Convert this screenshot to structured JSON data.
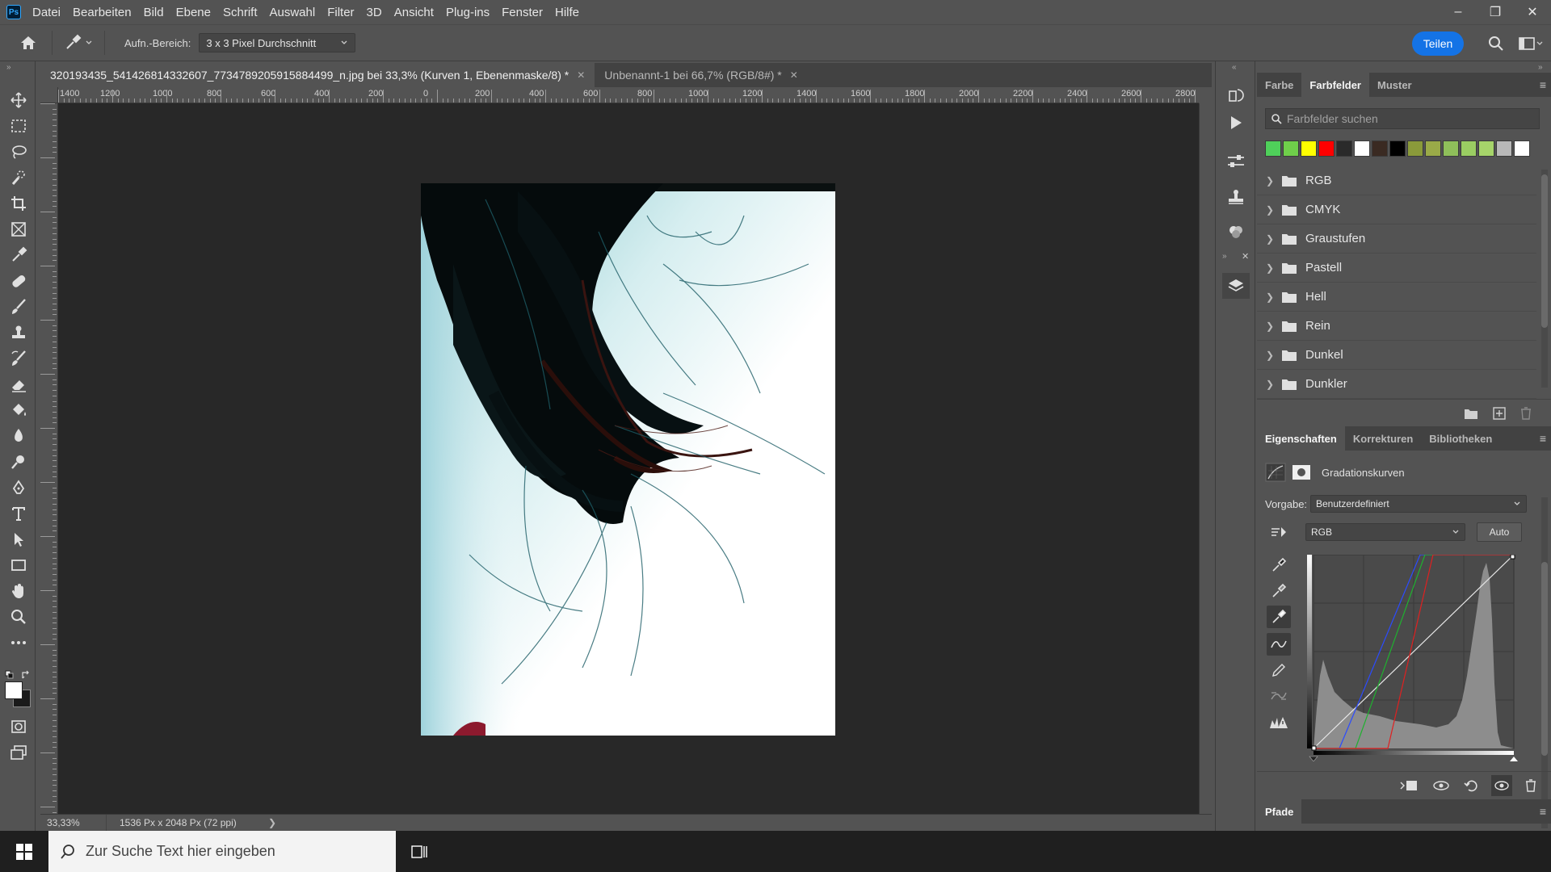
{
  "app": {
    "logo_text": "Ps"
  },
  "menubar": {
    "items": [
      "Datei",
      "Bearbeiten",
      "Bild",
      "Ebene",
      "Schrift",
      "Auswahl",
      "Filter",
      "3D",
      "Ansicht",
      "Plug-ins",
      "Fenster",
      "Hilfe"
    ]
  },
  "window_controls": {
    "minimize": "–",
    "restore": "❐",
    "close": "✕"
  },
  "options": {
    "sample_label": "Aufn.-Bereich:",
    "sample_value": "3 x 3 Pixel Durchschnitt",
    "share_label": "Teilen"
  },
  "tabs": [
    {
      "title": "320193435_541426814332607_7734789205915884499_n.jpg bei 33,3% (Kurven 1, Ebenenmaske/8) *",
      "close": "✕"
    },
    {
      "title": "Unbenannt-1 bei 66,7% (RGB/8#) *",
      "close": "✕"
    }
  ],
  "ruler_h": [
    "1400",
    "1200",
    "1000",
    "800",
    "600",
    "400",
    "200",
    "0",
    "200",
    "400",
    "600",
    "800",
    "1000",
    "1200",
    "1400",
    "1600",
    "1800",
    "2000",
    "2200",
    "2400",
    "2600",
    "2800"
  ],
  "status": {
    "zoom": "33,33%",
    "dimensions": "1536 Px x 2048 Px (72 ppi)",
    "arrow": "❯"
  },
  "swatches_panel": {
    "tabs": [
      "Farbe",
      "Farbfelder",
      "Muster"
    ],
    "search_placeholder": "Farbfelder suchen",
    "recent": [
      "#4fd05a",
      "#6fcf4a",
      "#ffff00",
      "#ff0000",
      "#2a2a2a",
      "#ffffff",
      "#3a2a22",
      "#000000",
      "#8a9a3a",
      "#9aaa48",
      "#8fbf5a",
      "#9acd62",
      "#a6d46a",
      "#b8b8b8",
      "#ffffff"
    ],
    "groups": [
      "RGB",
      "CMYK",
      "Graustufen",
      "Pastell",
      "Hell",
      "Rein",
      "Dunkel",
      "Dunkler"
    ]
  },
  "properties_panel": {
    "tabs": [
      "Eigenschaften",
      "Korrekturen",
      "Bibliotheken"
    ],
    "layer_title": "Gradationskurven",
    "preset_label": "Vorgabe:",
    "preset_value": "Benutzerdefiniert",
    "channel_value": "RGB",
    "auto_label": "Auto"
  },
  "paths_panel": {
    "title": "Pfade"
  },
  "taskbar": {
    "search_placeholder": "Zur Suche Text hier eingeben"
  }
}
